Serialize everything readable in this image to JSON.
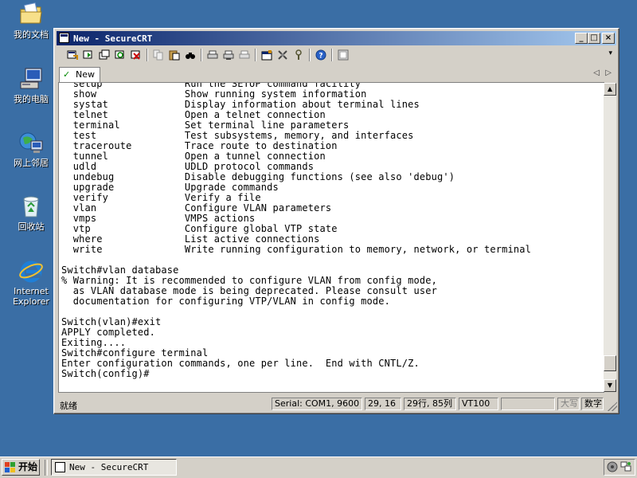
{
  "desktop": {
    "icons": [
      {
        "label": "我的文档",
        "icon": "folder-documents-icon"
      },
      {
        "label": "我的电脑",
        "icon": "computer-icon"
      },
      {
        "label": "网上邻居",
        "icon": "network-icon"
      },
      {
        "label": "回收站",
        "icon": "recycle-bin-icon"
      },
      {
        "label_line1": "Internet",
        "label_line2": "Explorer",
        "icon": "internet-explorer-icon"
      }
    ]
  },
  "window": {
    "title": "New - SecureCRT",
    "controls": {
      "minimize": "_",
      "maximize": "□",
      "close": "×"
    }
  },
  "toolbar": {
    "buttons": [
      "connect-icon",
      "quick-connect-icon",
      "connect-tab-icon",
      "reconnect-icon",
      "disconnect-icon",
      "copy-icon",
      "paste-icon",
      "find-icon",
      "print-icon",
      "print-selection-icon",
      "print-setup-icon",
      "session-options-icon",
      "global-options-icon",
      "keymap-icon",
      "help-icon",
      "screenshot-icon"
    ]
  },
  "tabs": [
    {
      "label": "New",
      "active": true
    }
  ],
  "terminal": {
    "lines": [
      "  setup              Run the SETUP command facility",
      "  show               Show running system information",
      "  systat             Display information about terminal lines",
      "  telnet             Open a telnet connection",
      "  terminal           Set terminal line parameters",
      "  test               Test subsystems, memory, and interfaces",
      "  traceroute         Trace route to destination",
      "  tunnel             Open a tunnel connection",
      "  udld               UDLD protocol commands",
      "  undebug            Disable debugging functions (see also 'debug')",
      "  upgrade            Upgrade commands",
      "  verify             Verify a file",
      "  vlan               Configure VLAN parameters",
      "  vmps               VMPS actions",
      "  vtp                Configure global VTP state",
      "  where              List active connections",
      "  write              Write running configuration to memory, network, or terminal",
      "",
      "Switch#vlan database",
      "% Warning: It is recommended to configure VLAN from config mode,",
      "  as VLAN database mode is being deprecated. Please consult user",
      "  documentation for configuring VTP/VLAN in config mode.",
      "",
      "Switch(vlan)#exit",
      "APPLY completed.",
      "Exiting....",
      "Switch#configure terminal",
      "Enter configuration commands, one per line.  End with CNTL/Z.",
      "Switch(config)#"
    ]
  },
  "scrollbar": {
    "position": 0.97
  },
  "statusbar": {
    "ready": "就绪",
    "connection": "Serial: COM1, 9600",
    "cursor": "29, 16",
    "size": "29行, 85列",
    "emulation": "VT100",
    "blank": "",
    "caps": "大写",
    "num": "数字"
  },
  "taskbar": {
    "start_label": "开始",
    "task_title": "New - SecureCRT"
  },
  "colors": {
    "desktop": "#3a6ea5",
    "titlebar_start": "#0a246a",
    "titlebar_end": "#a6caf0",
    "chrome": "#d4d0c8"
  }
}
